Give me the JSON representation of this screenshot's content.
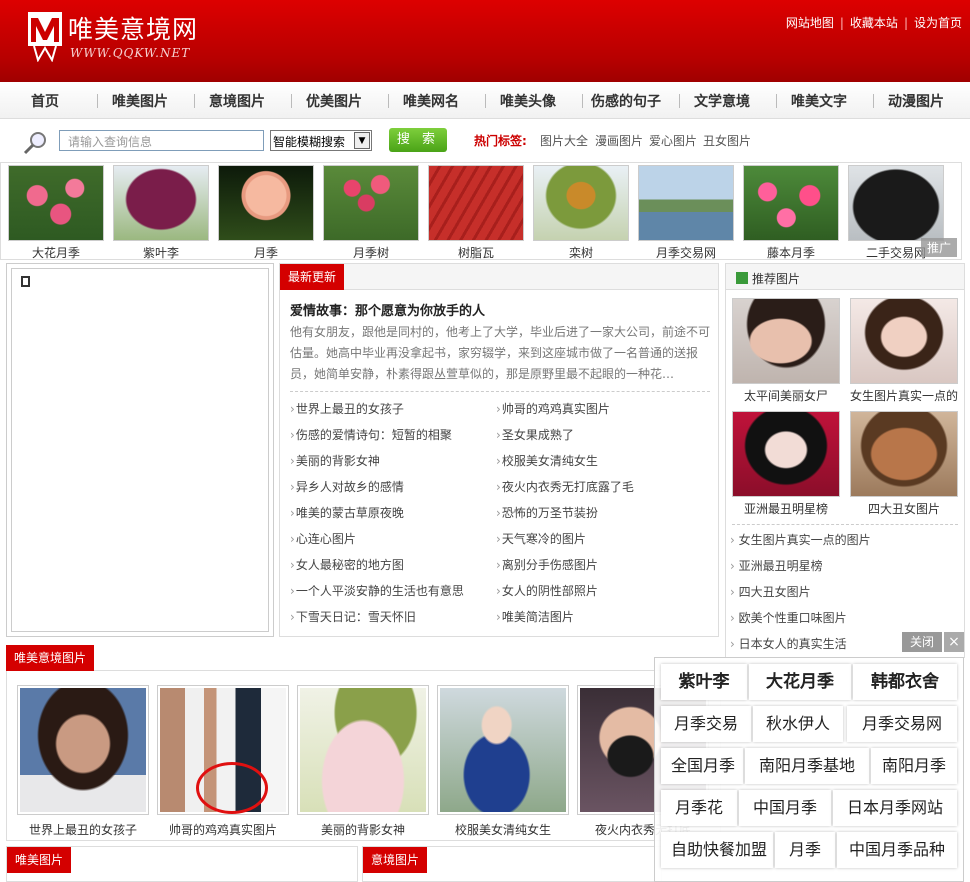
{
  "header": {
    "site_name": "唯美意境网",
    "site_url": "WWW.QQKW.NET",
    "top_links": [
      "网站地图",
      "收藏本站",
      "设为首页"
    ]
  },
  "nav": [
    "首页",
    "唯美图片",
    "意境图片",
    "优美图片",
    "唯美网名",
    "唯美头像",
    "伤感的句子",
    "文学意境",
    "唯美文字",
    "动漫图片"
  ],
  "search": {
    "placeholder": "请输入查询信息",
    "mode": "智能模糊搜索",
    "button": "搜 索",
    "hot_label": "热门标签:",
    "hot_tags": [
      "图片大全",
      "漫画图片",
      "爱心图片",
      "丑女图片"
    ]
  },
  "strip": {
    "items": [
      "大花月季",
      "紫叶李",
      "月季",
      "月季树",
      "树脂瓦",
      "栾树",
      "月季交易网",
      "藤本月季",
      "二手交易网"
    ],
    "ad_label": "推广"
  },
  "latest": {
    "tab": "最新更新",
    "story_title": "爱情故事：那个愿意为你放手的人",
    "story_text": "他有女朋友，跟他是同村的，他考上了大学，毕业后进了一家大公司，前途不可估量。她高中毕业再没拿起书，家穷辍学，来到这座城市做了一名普通的送报员，她简单安静，朴素得跟丛萱草似的，那是原野里最不起眼的一种花…",
    "left_links": [
      "世界上最丑的女孩子",
      "伤感的爱情诗句：短暂的相聚",
      "美丽的背影女神",
      "异乡人对故乡的感情",
      "唯美的蒙古草原夜晚",
      "心连心图片",
      "女人最秘密的地方图",
      "一个人平淡安静的生活也有意思",
      "下雪天日记：雪天怀旧"
    ],
    "right_links": [
      "帅哥的鸡鸡真实图片",
      "圣女果成熟了",
      "校服美女清纯女生",
      "夜火内衣秀无打底露了毛",
      "恐怖的万圣节装扮",
      "天气寒冷的图片",
      "离别分手伤感图片",
      "女人的阴性部照片",
      "唯美简洁图片"
    ]
  },
  "recommend": {
    "title": "推荐图片",
    "pics": [
      "太平间美丽女尸",
      "女生图片真实一点的",
      "亚洲最丑明星榜",
      "四大丑女图片"
    ],
    "links": [
      "女生图片真实一点的图片",
      "亚洲最丑明星榜",
      "四大丑女图片",
      "欧美个性重口味图片",
      "日本女人的真实生活"
    ]
  },
  "gallery": {
    "tab": "唯美意境图片",
    "items": [
      "世界上最丑的女孩子",
      "帅哥的鸡鸡真实图片",
      "美丽的背影女神",
      "校服美女清纯女生",
      "夜火内衣秀无打底"
    ]
  },
  "bottom_tabs": [
    "唯美图片",
    "意境图片"
  ],
  "float_ad": {
    "close": "关闭",
    "close_x": "×",
    "keywords": [
      [
        "紫叶李",
        "大花月季",
        "韩都衣舍"
      ],
      [
        "月季交易",
        "秋水伊人",
        "月季交易网"
      ],
      [
        "全国月季",
        "南阳月季基地",
        "南阳月季"
      ],
      [
        "月季花",
        "中国月季",
        "日本月季网站"
      ],
      [
        "自助快餐加盟",
        "月季",
        "中国月季品种"
      ]
    ]
  },
  "colors": {
    "brand_red": "#c40000",
    "search_green": "#5cb522",
    "hot_red": "#cc0000"
  }
}
